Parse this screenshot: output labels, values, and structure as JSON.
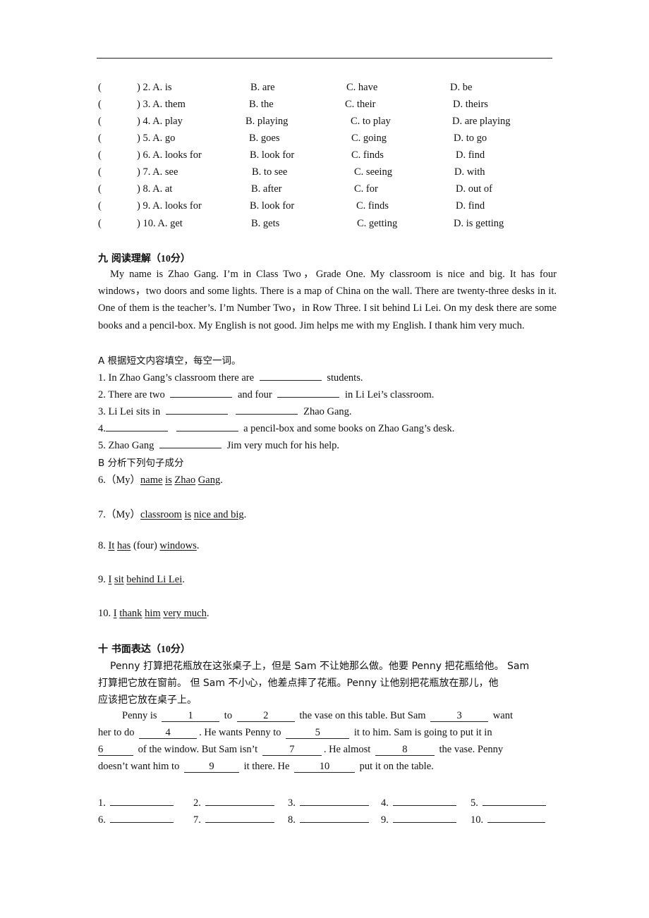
{
  "multiple_choice": [
    {
      "num": ") 2. A. is",
      "b": "B. are",
      "c": "C. have",
      "d": "D. be"
    },
    {
      "num": ") 3. A. them",
      "b": "B. the",
      "c": "C. their",
      "d": "D. theirs"
    },
    {
      "num": ") 4. A. play",
      "b": "B. playing",
      "c": "C. to play",
      "d": "D. are playing"
    },
    {
      "num": ") 5. A. go",
      "b": "B. goes",
      "c": "C. going",
      "d": "D. to go"
    },
    {
      "num": ") 6. A. looks for",
      "b": "B. look for",
      "c": "C. finds",
      "d": "D. find"
    },
    {
      "num": ") 7. A. see",
      "b": "B. to see",
      "c": "C. seeing",
      "d": "D. with"
    },
    {
      "num": ") 8. A. at",
      "b": "B. after",
      "c": "C. for",
      "d": "D. out of"
    },
    {
      "num": ") 9. A. looks for",
      "b": "B. look for",
      "c": "C. finds",
      "d": "D. find"
    },
    {
      "num": ") 10. A. get",
      "b": "B. gets",
      "c": "C. getting",
      "d": "D. is getting"
    }
  ],
  "paren_open": "(",
  "reading": {
    "title_prefix": "九 阅读理解（",
    "title_score": "10",
    "title_suffix": "分）",
    "passage": "My name is Zhao Gang. I’m in Class Two，Grade One. My classroom is nice and big. It has four windows，two doors and some lights. There is a map of China on the wall. There are twenty-three desks in it. One of them is the teacher’s. I’m Number Two，in Row Three. I sit behind Li Lei. On my desk there are some books and a pencil-box. My English is not good. Jim helps me with my English. I thank him very much.",
    "part_a_title": "A  根据短文内容填空，每空一词。",
    "part_a": {
      "q1_a": "1. In Zhao Gang’s classroom there are",
      "q1_b": "students.",
      "q2_a": "2. There are two",
      "q2_b": "and four",
      "q2_c": "in Li Lei’s classroom.",
      "q3_a": "3. Li Lei sits in",
      "q3_b": "Zhao Gang.",
      "q4_a": "4.",
      "q4_b": "a pencil-box and some books on Zhao Gang’s desk.",
      "q5_a": "5. Zhao Gang",
      "q5_b": "Jim very much for his help."
    },
    "part_b_title": "B  分析下列句子成分",
    "part_b": {
      "q6": {
        "num": "6.（My）",
        "w1": "name",
        "w2": "is",
        "w3": "Zhao",
        "w4": "Gang",
        "end": "."
      },
      "q7": {
        "num": "7.（My）",
        "w1": "classroom",
        "w2": "is",
        "w3": "nice and big",
        "end": "."
      },
      "q8": {
        "num": "8. ",
        "w1": "It",
        "w2": "has",
        "mid": " (four) ",
        "w3": "windows",
        "end": "."
      },
      "q9": {
        "num": "9. ",
        "w1": "I",
        "w2": "sit",
        "w3": "behind Li Lei",
        "end": "."
      },
      "q10": {
        "num": "10. ",
        "w1": "I",
        "w2": "thank",
        "w3": "him",
        "w4": "very much",
        "end": "."
      }
    }
  },
  "writing": {
    "title_prefix": "十 书面表达（",
    "title_score": "10",
    "title_suffix": "分）",
    "chinese_l1": "Penny 打算把花瓶放在这张桌子上，但是 Sam 不让她那么做。他要 Penny 把花瓶给他。 Sam",
    "chinese_l2": "打算把它放在窗前。 但 Sam 不小心，他差点摔了花瓶。Penny 让他别把花瓶放在那儿，他",
    "chinese_l3": "应该把它放在桌子上。",
    "cloze": {
      "t1": "Penny is",
      "b1": "1",
      "t2": "to",
      "b2": "2",
      "t3": "the vase on this table. But Sam",
      "b3": "3",
      "t4": "want",
      "t5": "her to do",
      "b4": "4",
      "t6": ". He wants Penny to",
      "b5": "5",
      "t7": "it to him. Sam is going to put it in",
      "b6": "6",
      "t8": "of the window. But Sam isn’t",
      "b7": "7",
      "t9": ". He almost",
      "b8": "8",
      "t10": "the vase. Penny",
      "t11": "doesn’t want him to",
      "b9": "9",
      "t12": "it there. He",
      "b10": "10",
      "t13": "put it on the table."
    },
    "answer_labels": [
      "1.",
      "2.",
      "3.",
      "4.",
      "5.",
      "6.",
      "7.",
      "8.",
      "9.",
      "10."
    ]
  }
}
